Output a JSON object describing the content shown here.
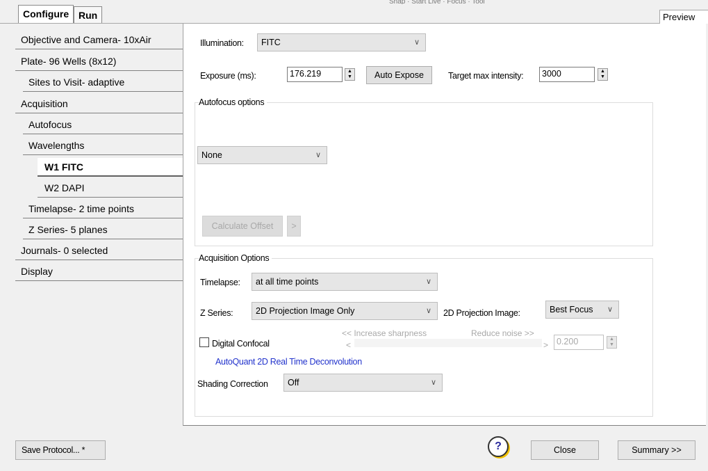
{
  "tabs": [
    "Configure",
    "Run"
  ],
  "preview_label": "Preview",
  "sidebar": {
    "items": [
      {
        "label": "Objective and Camera- 10xAir",
        "indent": 0
      },
      {
        "label": "Plate- 96 Wells (8x12)",
        "indent": 0
      },
      {
        "label": "Sites to Visit- adaptive",
        "indent": 1
      },
      {
        "label": "Acquisition",
        "indent": 0
      },
      {
        "label": "Autofocus",
        "indent": 1
      },
      {
        "label": "Wavelengths",
        "indent": 1
      },
      {
        "label": "W1 FITC",
        "indent": 2
      },
      {
        "label": "W2 DAPI",
        "indent": 2
      },
      {
        "label": "Timelapse- 2 time points",
        "indent": 1
      },
      {
        "label": "Z Series- 5 planes",
        "indent": 1
      },
      {
        "label": "Journals- 0 selected",
        "indent": 0
      },
      {
        "label": "Display",
        "indent": 0
      }
    ]
  },
  "illumination": {
    "label": "Illumination:",
    "value": "FITC"
  },
  "exposure": {
    "label": "Exposure (ms):",
    "value": "176.219",
    "auto_button": "Auto Expose",
    "target_label": "Target max intensity:",
    "target_value": "3000"
  },
  "autofocus": {
    "title": "Autofocus options",
    "value": "None",
    "calc_button": "Calculate Offset",
    "arrow_button": ">"
  },
  "acquisition": {
    "title": "Acquisition Options",
    "timelapse_label": "Timelapse:",
    "timelapse_value": "at all time points",
    "zseries_label": "Z Series:",
    "zseries_value": "2D Projection Image Only",
    "projection_label": "2D Projection Image:",
    "projection_value": "Best Focus",
    "digital_confocal": "Digital Confocal",
    "sharpness_label": "<< Increase sharpness",
    "noise_label": "Reduce noise >>",
    "slider_left": "<",
    "slider_right": ">",
    "slider_value": "0.200",
    "autoquant_link": "AutoQuant 2D Real Time Deconvolution",
    "shading_label": "Shading Correction",
    "shading_value": "Off"
  },
  "footer": {
    "save_button": "Save Protocol... *",
    "help_icon": "?",
    "close_button": "Close",
    "summary_button": "Summary >>"
  }
}
